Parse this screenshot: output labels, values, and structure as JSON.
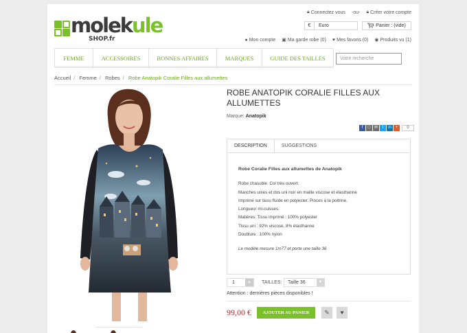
{
  "header": {
    "logo_text_a": "molek",
    "logo_text_b": "ule",
    "logo_sub": "SHOP.fr",
    "connect_label": "Connectez vous",
    "or_label": "-ou-",
    "create_label": "Créer votre compte",
    "currency_symbol": "€",
    "currency_value": "Euro",
    "cart_label": "Panier : (vide)",
    "account_links": [
      {
        "label": "Mon compte",
        "icon": "user-icon"
      },
      {
        "label": "Ma garde robe (0)",
        "icon": "hanger-icon"
      },
      {
        "label": "Mes favoris (0)",
        "icon": "heart-icon"
      },
      {
        "label": "Produits vu (1)",
        "icon": "eye-icon"
      }
    ]
  },
  "menu": {
    "items": [
      "FEMME",
      "ACCESSOIRES",
      "BONNES AFFAIRES",
      "MARQUES",
      "GUIDE DES TAILLES"
    ],
    "search_placeholder": "Votre recherche"
  },
  "breadcrumb": [
    "Accueil",
    "Femme",
    "Robes",
    "Robe Anatopik Coralie Filles aux allumettes"
  ],
  "product": {
    "title": "ROBE ANATOPIK CORALIE FILLES AUX ALLUMETTES",
    "brand_label": "Marque:",
    "brand": "Anatopik",
    "share_count": "0",
    "tabs": [
      "DESCRIPTION",
      "SUGGESTIONS"
    ],
    "desc_title": "Robe Coralie Filles aux allumettes de Anatopik",
    "desc_lines": [
      "Robe chasuble. Col très ouvert.",
      "Manches unies et dos uni noir en maille viscose et élasthanne",
      "Imprimé sur tissu fluide en polyester. Pinces à la poitrine.",
      "Longueur mi-cuisses.",
      "Matières: Tissu imprimé : 100% polyester",
      "Tissu uni : 92% viscose, 8% élasthanne",
      "Doublure : 100% nylon"
    ],
    "desc_note": "Le modèle mesure 1m77 et porte une taille 36",
    "quantity": "1",
    "size_label": "TAILLES:",
    "size_value": "Taille 36",
    "availability": "Attention : dernières pièces disponibles !",
    "price": "99,00 €",
    "add_to_cart": "AJOUTER AU PANIER"
  },
  "colors": {
    "accent": "#7bbf2a",
    "price": "#c1272d"
  }
}
